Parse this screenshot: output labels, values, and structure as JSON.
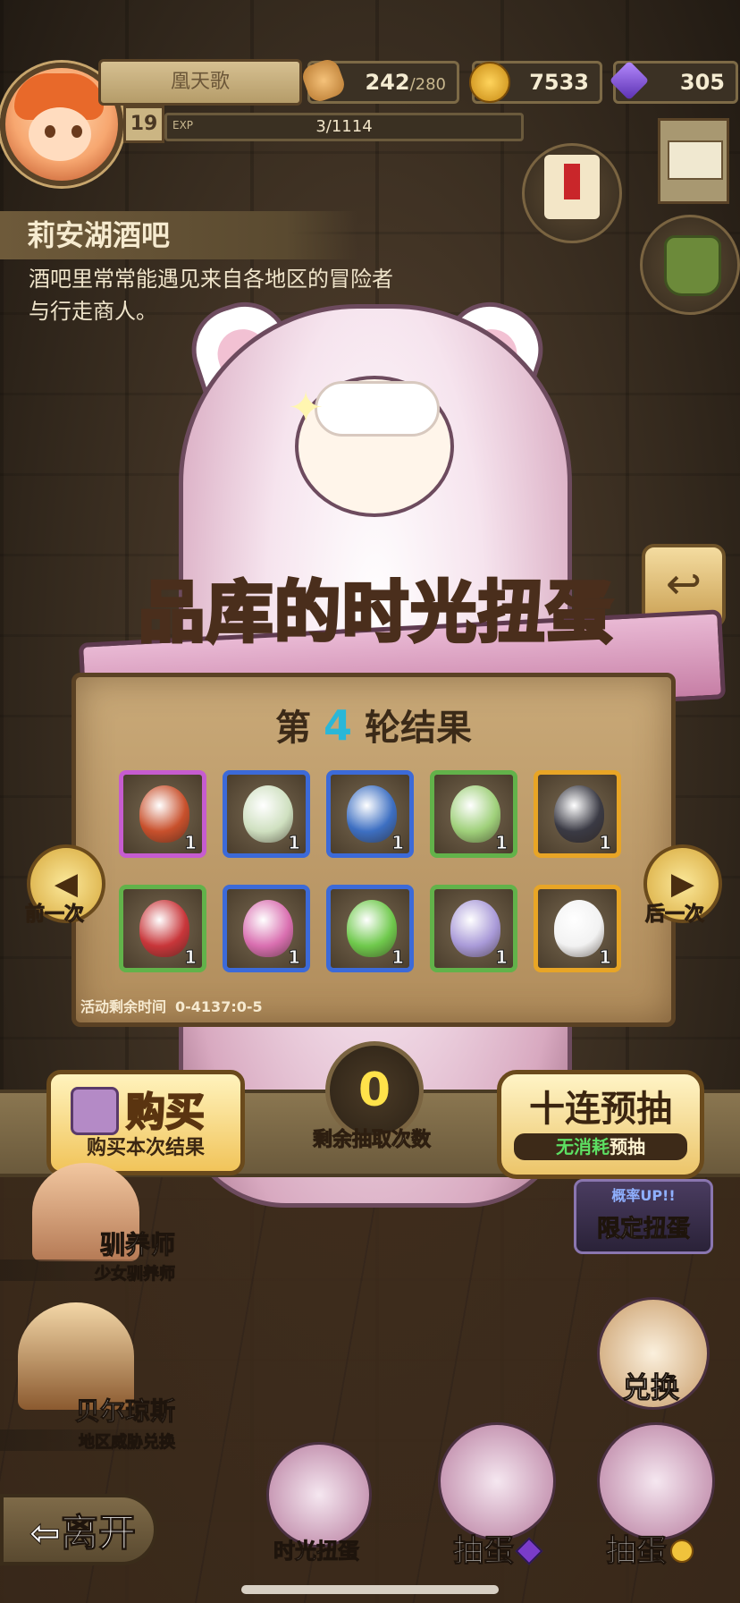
{
  "player": {
    "name": "凰天歌",
    "level": "19",
    "exp_label": "EXP",
    "exp_value": "3/1114"
  },
  "resources": {
    "stamina": "242",
    "stamina_max": "/280",
    "gold": "7533",
    "gems": "305"
  },
  "location": {
    "title": "莉安湖酒吧",
    "description": "酒吧里常常能遇见来自各地区的冒险者与行走商人。"
  },
  "gacha": {
    "title_prefix": "品库的",
    "title_accent": "时光",
    "title_suffix": "扭蛋",
    "round_prefix": "第",
    "round_number": "4",
    "round_suffix": "轮结果",
    "timer_label": "活动剩余时间",
    "timer_value": "0-4137:0-5",
    "items": [
      {
        "name": "feather-egg-icon",
        "rarity": "purple",
        "count": "1",
        "color": "#c8502c"
      },
      {
        "name": "leaf-pod-icon",
        "rarity": "blue",
        "count": "1",
        "color": "#cfe0c0"
      },
      {
        "name": "blue-eye-orb-icon",
        "rarity": "blue",
        "count": "1",
        "color": "#3d6fc2"
      },
      {
        "name": "green-scarf-egg-icon",
        "rarity": "green",
        "count": "1",
        "color": "#9fd07a"
      },
      {
        "name": "dark-crystal-egg-icon",
        "rarity": "gold",
        "count": "1",
        "color": "#3a3a44"
      },
      {
        "name": "red-pattern-egg-icon",
        "rarity": "green",
        "count": "1",
        "color": "#c8363a"
      },
      {
        "name": "mushroom-egg-icon",
        "rarity": "blue",
        "count": "1",
        "color": "#d96fb0"
      },
      {
        "name": "green-slime-egg-icon",
        "rarity": "blue",
        "count": "1",
        "color": "#6fc94c"
      },
      {
        "name": "lavender-bud-icon",
        "rarity": "green",
        "count": "1",
        "color": "#a99ad8"
      },
      {
        "name": "angel-egg-icon",
        "rarity": "gold",
        "count": "1",
        "color": "#f2f2f2"
      }
    ],
    "prev_label": "前一次",
    "next_label": "后一次",
    "buy_label": "购买",
    "buy_sub": "购买本次结果",
    "remaining_count": "0",
    "remaining_label": "剩余抽取次数",
    "ten_label": "十连预抽",
    "ten_sub_green": "无消耗",
    "ten_sub_white": "预抽"
  },
  "npcs": [
    {
      "name": "驯养师",
      "sub": "少女驯养师"
    },
    {
      "name": "贝尔琼斯",
      "sub": "地区威胁兑换"
    }
  ],
  "menus": {
    "limited_tag": "概率UP!!",
    "limited_label": "限定扭蛋",
    "exchange_label": "兑换",
    "time_gacha_label": "时光扭蛋",
    "draw_gem_label": "抽蛋",
    "draw_gold_label": "抽蛋"
  },
  "leave_label": "离开",
  "colors": {
    "accent_gold": "#ffe37a",
    "accent_purple": "#9b5cff",
    "round_number": "#2ab7d8"
  }
}
